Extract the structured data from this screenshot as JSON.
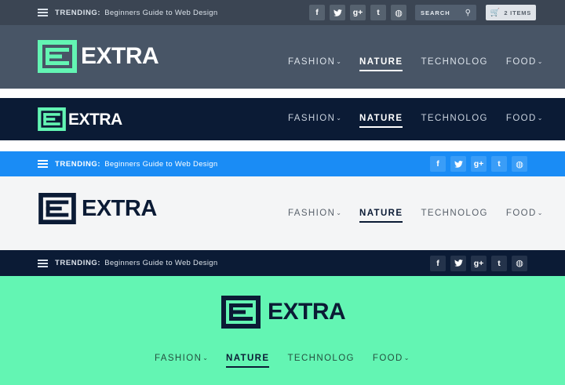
{
  "colors": {
    "slate": "#485566",
    "slate_bar": "#3b4553",
    "navy": "#0b1b35",
    "blue": "#1a8cf5",
    "white_band": "#f4f5f6",
    "mint": "#63f5b3",
    "logo_green": "#63f5b3"
  },
  "trending": {
    "label": "TRENDING:",
    "text": "Beginners Guide to Web Design"
  },
  "social": {
    "facebook": "f",
    "twitter": "🐦",
    "googleplus": "g+",
    "tumblr": "t",
    "dribbble": "◍"
  },
  "social_icons": [
    "facebook-icon",
    "twitter-icon",
    "google-plus-icon",
    "tumblr-icon",
    "dribbble-icon"
  ],
  "search": {
    "label": "SEARCH"
  },
  "cart": {
    "label": "2 ITEMS"
  },
  "logo": {
    "text": "EXTRA"
  },
  "nav": {
    "items": [
      {
        "label": "FASHION",
        "has_dropdown": true
      },
      {
        "label": "NATURE",
        "has_dropdown": false,
        "active": true
      },
      {
        "label": "TECHNOLOG",
        "has_dropdown": false
      },
      {
        "label": "FOOD",
        "has_dropdown": true
      }
    ]
  }
}
